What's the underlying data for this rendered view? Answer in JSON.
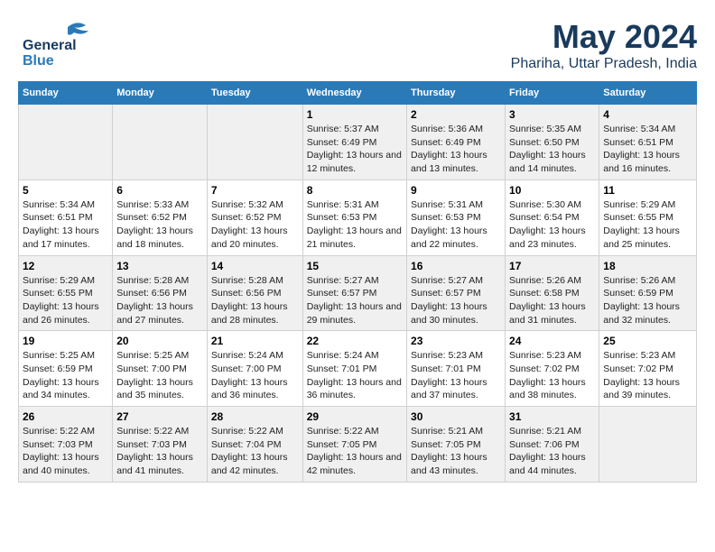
{
  "logo": {
    "general": "General",
    "blue": "Blue"
  },
  "title": "May 2024",
  "subtitle": "Phariha, Uttar Pradesh, India",
  "days_of_week": [
    "Sunday",
    "Monday",
    "Tuesday",
    "Wednesday",
    "Thursday",
    "Friday",
    "Saturday"
  ],
  "weeks": [
    [
      {
        "day": "",
        "info": ""
      },
      {
        "day": "",
        "info": ""
      },
      {
        "day": "",
        "info": ""
      },
      {
        "day": "1",
        "info": "Sunrise: 5:37 AM\nSunset: 6:49 PM\nDaylight: 13 hours and 12 minutes."
      },
      {
        "day": "2",
        "info": "Sunrise: 5:36 AM\nSunset: 6:49 PM\nDaylight: 13 hours and 13 minutes."
      },
      {
        "day": "3",
        "info": "Sunrise: 5:35 AM\nSunset: 6:50 PM\nDaylight: 13 hours and 14 minutes."
      },
      {
        "day": "4",
        "info": "Sunrise: 5:34 AM\nSunset: 6:51 PM\nDaylight: 13 hours and 16 minutes."
      }
    ],
    [
      {
        "day": "5",
        "info": "Sunrise: 5:34 AM\nSunset: 6:51 PM\nDaylight: 13 hours and 17 minutes."
      },
      {
        "day": "6",
        "info": "Sunrise: 5:33 AM\nSunset: 6:52 PM\nDaylight: 13 hours and 18 minutes."
      },
      {
        "day": "7",
        "info": "Sunrise: 5:32 AM\nSunset: 6:52 PM\nDaylight: 13 hours and 20 minutes."
      },
      {
        "day": "8",
        "info": "Sunrise: 5:31 AM\nSunset: 6:53 PM\nDaylight: 13 hours and 21 minutes."
      },
      {
        "day": "9",
        "info": "Sunrise: 5:31 AM\nSunset: 6:53 PM\nDaylight: 13 hours and 22 minutes."
      },
      {
        "day": "10",
        "info": "Sunrise: 5:30 AM\nSunset: 6:54 PM\nDaylight: 13 hours and 23 minutes."
      },
      {
        "day": "11",
        "info": "Sunrise: 5:29 AM\nSunset: 6:55 PM\nDaylight: 13 hours and 25 minutes."
      }
    ],
    [
      {
        "day": "12",
        "info": "Sunrise: 5:29 AM\nSunset: 6:55 PM\nDaylight: 13 hours and 26 minutes."
      },
      {
        "day": "13",
        "info": "Sunrise: 5:28 AM\nSunset: 6:56 PM\nDaylight: 13 hours and 27 minutes."
      },
      {
        "day": "14",
        "info": "Sunrise: 5:28 AM\nSunset: 6:56 PM\nDaylight: 13 hours and 28 minutes."
      },
      {
        "day": "15",
        "info": "Sunrise: 5:27 AM\nSunset: 6:57 PM\nDaylight: 13 hours and 29 minutes."
      },
      {
        "day": "16",
        "info": "Sunrise: 5:27 AM\nSunset: 6:57 PM\nDaylight: 13 hours and 30 minutes."
      },
      {
        "day": "17",
        "info": "Sunrise: 5:26 AM\nSunset: 6:58 PM\nDaylight: 13 hours and 31 minutes."
      },
      {
        "day": "18",
        "info": "Sunrise: 5:26 AM\nSunset: 6:59 PM\nDaylight: 13 hours and 32 minutes."
      }
    ],
    [
      {
        "day": "19",
        "info": "Sunrise: 5:25 AM\nSunset: 6:59 PM\nDaylight: 13 hours and 34 minutes."
      },
      {
        "day": "20",
        "info": "Sunrise: 5:25 AM\nSunset: 7:00 PM\nDaylight: 13 hours and 35 minutes."
      },
      {
        "day": "21",
        "info": "Sunrise: 5:24 AM\nSunset: 7:00 PM\nDaylight: 13 hours and 36 minutes."
      },
      {
        "day": "22",
        "info": "Sunrise: 5:24 AM\nSunset: 7:01 PM\nDaylight: 13 hours and 36 minutes."
      },
      {
        "day": "23",
        "info": "Sunrise: 5:23 AM\nSunset: 7:01 PM\nDaylight: 13 hours and 37 minutes."
      },
      {
        "day": "24",
        "info": "Sunrise: 5:23 AM\nSunset: 7:02 PM\nDaylight: 13 hours and 38 minutes."
      },
      {
        "day": "25",
        "info": "Sunrise: 5:23 AM\nSunset: 7:02 PM\nDaylight: 13 hours and 39 minutes."
      }
    ],
    [
      {
        "day": "26",
        "info": "Sunrise: 5:22 AM\nSunset: 7:03 PM\nDaylight: 13 hours and 40 minutes."
      },
      {
        "day": "27",
        "info": "Sunrise: 5:22 AM\nSunset: 7:03 PM\nDaylight: 13 hours and 41 minutes."
      },
      {
        "day": "28",
        "info": "Sunrise: 5:22 AM\nSunset: 7:04 PM\nDaylight: 13 hours and 42 minutes."
      },
      {
        "day": "29",
        "info": "Sunrise: 5:22 AM\nSunset: 7:05 PM\nDaylight: 13 hours and 42 minutes."
      },
      {
        "day": "30",
        "info": "Sunrise: 5:21 AM\nSunset: 7:05 PM\nDaylight: 13 hours and 43 minutes."
      },
      {
        "day": "31",
        "info": "Sunrise: 5:21 AM\nSunset: 7:06 PM\nDaylight: 13 hours and 44 minutes."
      },
      {
        "day": "",
        "info": ""
      }
    ]
  ]
}
